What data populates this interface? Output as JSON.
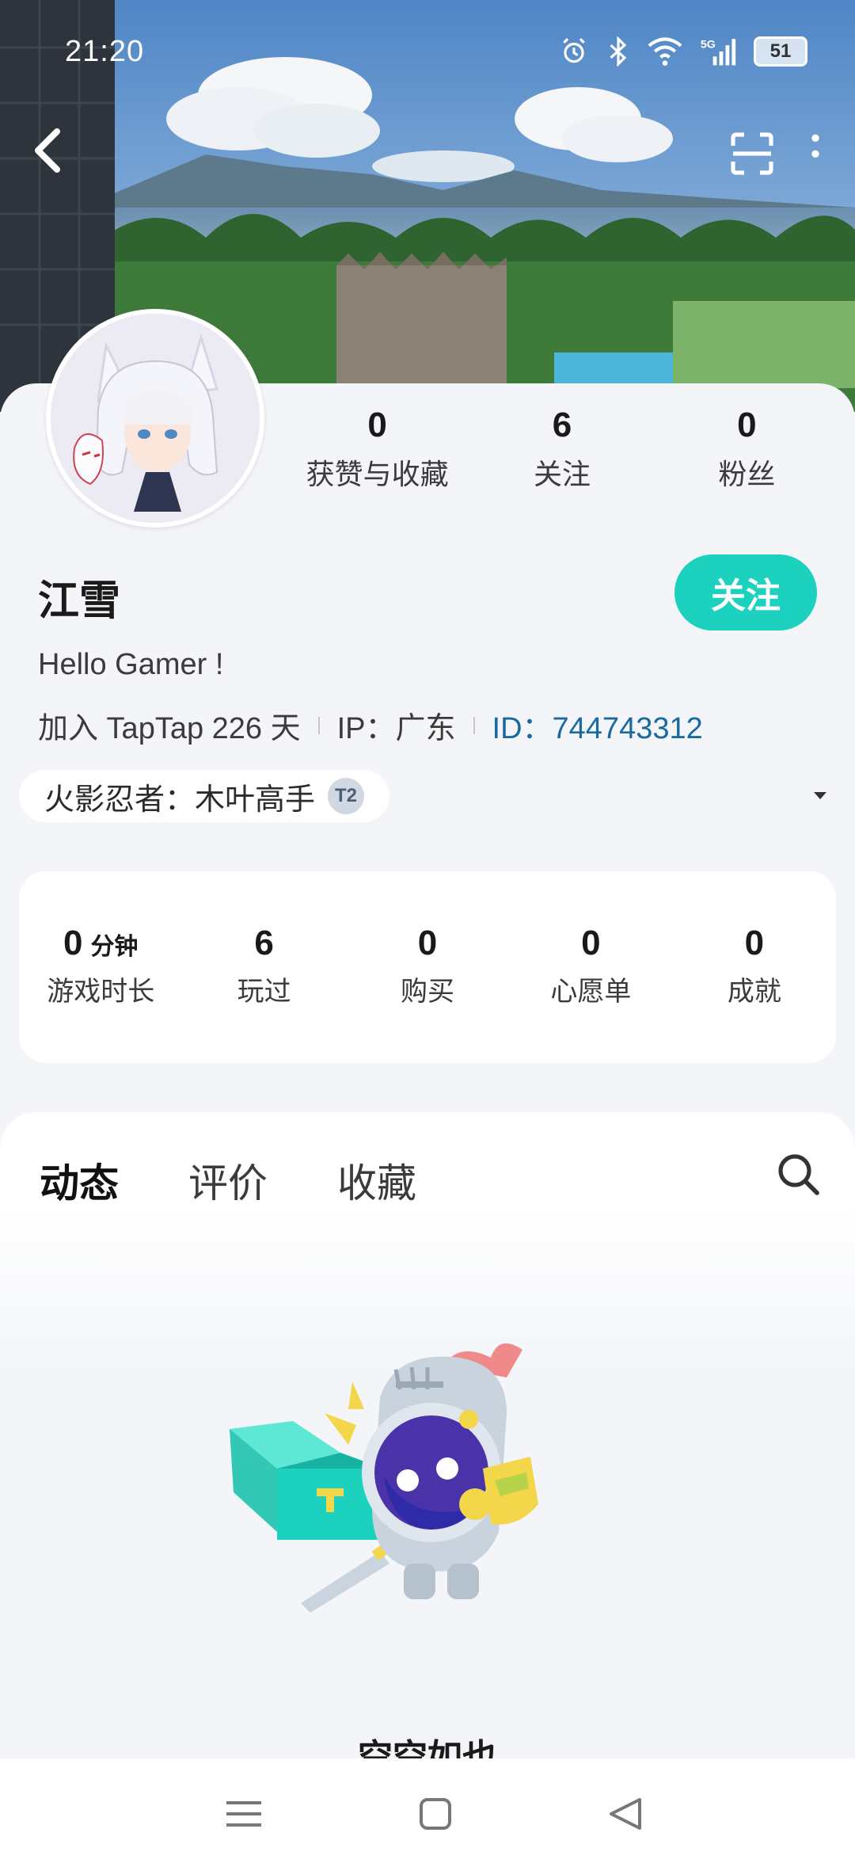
{
  "status_bar": {
    "time": "21:20",
    "battery": "51",
    "icons": [
      "alarm-icon",
      "bluetooth-icon",
      "wifi-icon",
      "5g-signal-icon",
      "battery-icon"
    ]
  },
  "profile": {
    "stats": [
      {
        "value": "0",
        "label": "获赞与收藏"
      },
      {
        "value": "6",
        "label": "关注"
      },
      {
        "value": "0",
        "label": "粉丝"
      }
    ],
    "username": "江雪",
    "follow_label": "关注",
    "bio": "Hello Gamer !",
    "joined": "加入 TapTap 226 天",
    "ip": "IP：广东",
    "id": "ID：744743312",
    "title": "火影忍者：木叶高手",
    "title_badge": "T2"
  },
  "game_stats": [
    {
      "value": "0",
      "unit": "分钟",
      "label": "游戏时长"
    },
    {
      "value": "6",
      "unit": "",
      "label": "玩过"
    },
    {
      "value": "0",
      "unit": "",
      "label": "购买"
    },
    {
      "value": "0",
      "unit": "",
      "label": "心愿单"
    },
    {
      "value": "0",
      "unit": "",
      "label": "成就"
    }
  ],
  "tabs": [
    {
      "label": "动态",
      "active": true
    },
    {
      "label": "评价",
      "active": false
    },
    {
      "label": "收藏",
      "active": false
    }
  ],
  "empty_state": {
    "text": "空空如也"
  },
  "colors": {
    "accent": "#1dd1bf",
    "id_link": "#1a6aa0",
    "background": "#f3f5f8"
  }
}
